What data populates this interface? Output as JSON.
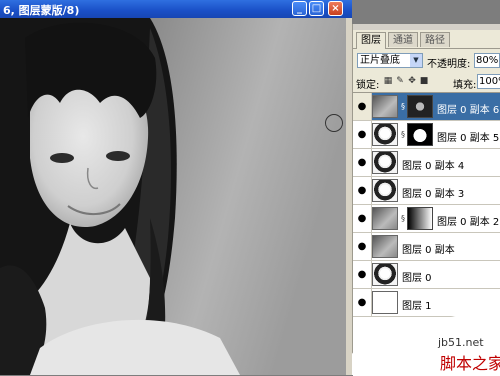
{
  "window": {
    "title": "6, 图层蒙版/8)",
    "minimize_glyph": "_",
    "maximize_glyph": "□",
    "close_glyph": "×"
  },
  "panel": {
    "tabs": [
      {
        "label": "图层",
        "active": true
      },
      {
        "label": "通道",
        "active": false
      },
      {
        "label": "路径",
        "active": false
      }
    ],
    "blend_mode": "正片叠底",
    "opacity_label": "不透明度:",
    "opacity_value": "80%",
    "lock_label": "锁定:",
    "lock_icons": [
      "lock-transparent-icon",
      "brush-icon",
      "move-icon",
      "lock-all-icon"
    ],
    "fill_label": "填充:",
    "fill_value": "100%",
    "layers": [
      {
        "name": "图层 0 副本 6",
        "thumb": "gray",
        "mask": "dark",
        "selected": true
      },
      {
        "name": "图层 0 副本 5",
        "thumb": "portrait",
        "mask": "silhouette",
        "selected": false
      },
      {
        "name": "图层 0 副本 4",
        "thumb": "portrait",
        "mask": null,
        "selected": false
      },
      {
        "name": "图层 0 副本 3",
        "thumb": "portrait",
        "mask": null,
        "selected": false
      },
      {
        "name": "图层 0 副本 2",
        "thumb": "gray",
        "mask": "gradient",
        "selected": false
      },
      {
        "name": "图层 0 副本",
        "thumb": "gray",
        "mask": null,
        "selected": false
      },
      {
        "name": "图层 0",
        "thumb": "portrait",
        "mask": null,
        "selected": false
      },
      {
        "name": "图层 1",
        "thumb": "blank",
        "mask": null,
        "selected": false
      }
    ]
  },
  "watermark": {
    "url": "jb51.net",
    "brand": "脚本之家"
  }
}
